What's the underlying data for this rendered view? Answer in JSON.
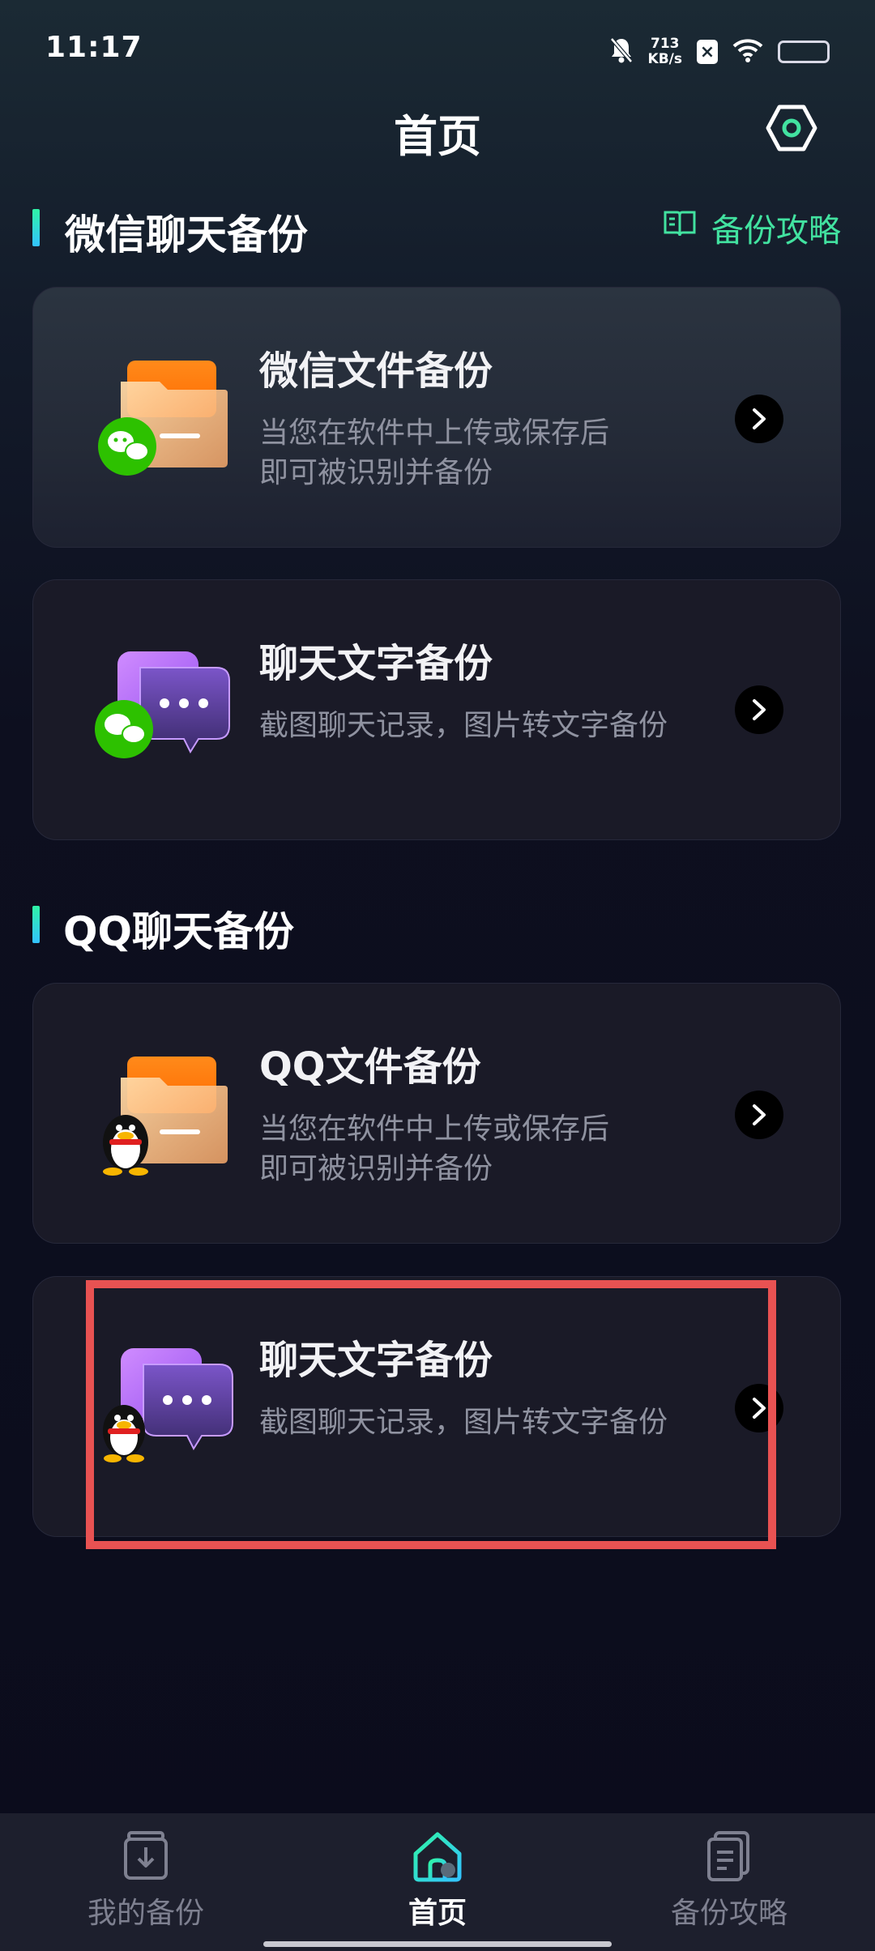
{
  "status_bar": {
    "time": "11:17",
    "speed_value": "713",
    "speed_unit": "KB/s"
  },
  "header": {
    "title": "首页"
  },
  "wechat_section": {
    "title": "微信聊天备份",
    "guide_label": "备份攻略",
    "cards": [
      {
        "title": "微信文件备份",
        "desc_line1": "当您在软件中上传或保存后",
        "desc_line2": "即可被识别并备份"
      },
      {
        "title": "聊天文字备份",
        "desc_line1": "截图聊天记录，图片转文字备份"
      }
    ]
  },
  "qq_section": {
    "title": "QQ聊天备份",
    "cards": [
      {
        "title": "QQ文件备份",
        "desc_line1": "当您在软件中上传或保存后",
        "desc_line2": "即可被识别并备份"
      },
      {
        "title": "聊天文字备份",
        "desc_line1": "截图聊天记录，图片转文字备份"
      }
    ]
  },
  "bottom_nav": {
    "items": [
      {
        "label": "我的备份",
        "active": false
      },
      {
        "label": "首页",
        "active": true
      },
      {
        "label": "备份攻略",
        "active": false
      }
    ]
  },
  "colors": {
    "accent_green": "#42e2a0",
    "highlight_box": "#e85252",
    "card_bg": "#1a1a27"
  }
}
